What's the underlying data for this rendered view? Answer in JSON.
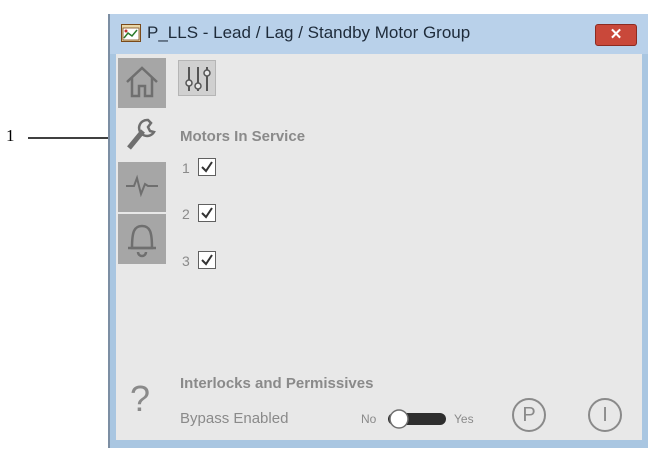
{
  "callout": {
    "number": "1"
  },
  "window": {
    "title": "P_LLS - Lead / Lag / Standby Motor Group",
    "close_glyph": "✕"
  },
  "nav": {
    "tabs": [
      {
        "icon": "home-icon",
        "active": false
      },
      {
        "icon": "wrench-icon",
        "active": true
      },
      {
        "icon": "trend-icon",
        "active": false
      },
      {
        "icon": "bell-icon",
        "active": false
      }
    ],
    "help_glyph": "?"
  },
  "motors_section": {
    "title": "Motors In Service",
    "motors": [
      {
        "number": "1",
        "checked": true
      },
      {
        "number": "2",
        "checked": true
      },
      {
        "number": "3",
        "checked": true
      }
    ]
  },
  "interlocks_section": {
    "title": "Interlocks and Permissives",
    "bypass_label": "Bypass Enabled",
    "toggle_no": "No",
    "toggle_yes": "Yes",
    "bypass_enabled": true
  },
  "buttons": {
    "permissives_glyph": "P",
    "interlocks_glyph": "I"
  },
  "colors": {
    "titlebar": "#b9d1ea",
    "close": "#c9483a",
    "tab_inactive": "#a6a6a6",
    "panel": "#e8e8e8",
    "label_gray": "#8a8a8a"
  }
}
